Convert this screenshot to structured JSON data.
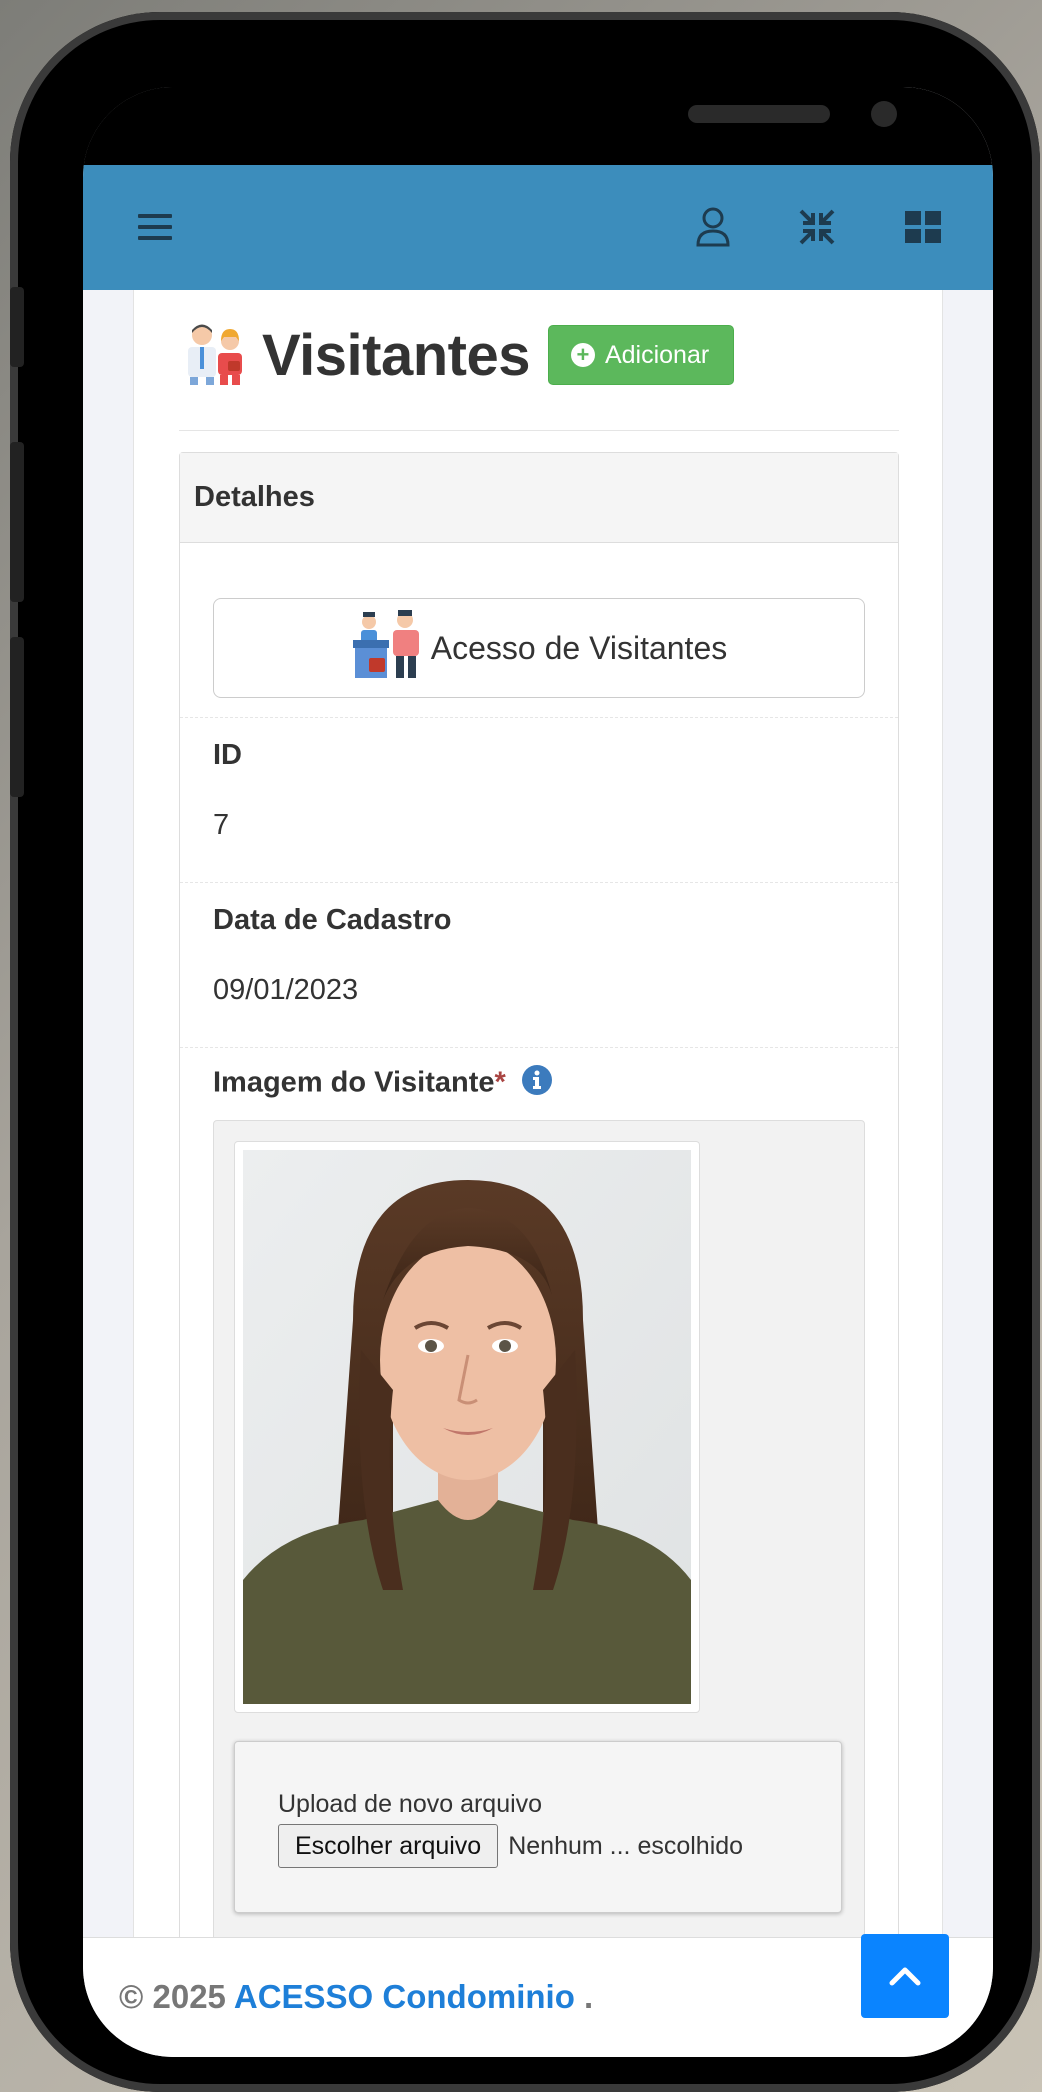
{
  "header": {
    "menu_icon": "hamburger-icon",
    "user_icon": "user-icon",
    "compress_icon": "compress-icon",
    "apps_icon": "grid-icon"
  },
  "page": {
    "title": "Visitantes",
    "add_label": "Adicionar"
  },
  "panel": {
    "heading": "Detalhes",
    "access_button_label": "Acesso de Visitantes",
    "fields": {
      "id_label": "ID",
      "id_value": "7",
      "date_label": "Data de Cadastro",
      "date_value": "09/01/2023",
      "image_label": "Imagem do Visitante",
      "required_mark": "*"
    },
    "upload": {
      "label": "Upload de novo arquivo",
      "button": "Escolher arquivo",
      "status": "Nenhum ... escolhido"
    }
  },
  "footer": {
    "copyright": "© 2025",
    "brand": "ACESSO Condominio",
    "suffix": "."
  },
  "colors": {
    "topbar": "#3c8dbc",
    "add_button": "#5cb85c",
    "brand_link": "#1e7fd8",
    "scroll_top": "#0a84ff"
  }
}
